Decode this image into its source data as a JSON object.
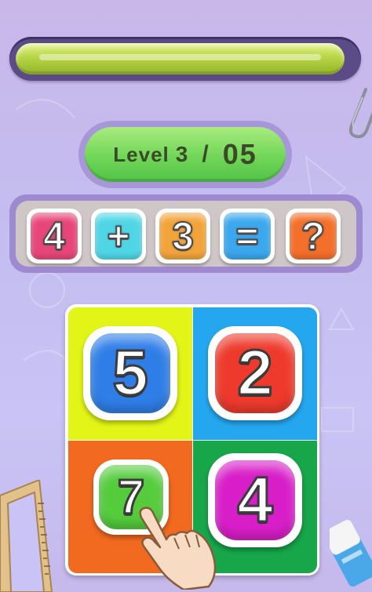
{
  "timer": {
    "progress": 0.97
  },
  "level": {
    "word": "Level",
    "current": "3",
    "separator": "/",
    "total": "05"
  },
  "equation": {
    "tiles": [
      {
        "text": "4",
        "color": "#e8467a"
      },
      {
        "text": "+",
        "color": "#4fd6e6"
      },
      {
        "text": "3",
        "color": "#f2a43a"
      },
      {
        "text": "=",
        "color": "#3aa7ee"
      },
      {
        "text": "?",
        "color": "#f36f2a"
      }
    ]
  },
  "answers": [
    {
      "value": "5",
      "bg": "#e2f516",
      "button_color": "#2f7ee8"
    },
    {
      "value": "2",
      "bg": "#25a7f0",
      "button_color": "#ee3a2c"
    },
    {
      "value": "7",
      "bg": "#f26a1f",
      "button_color": "#54cc3c"
    },
    {
      "value": "4",
      "bg": "#17a64a",
      "button_color": "#d81ec8"
    }
  ]
}
